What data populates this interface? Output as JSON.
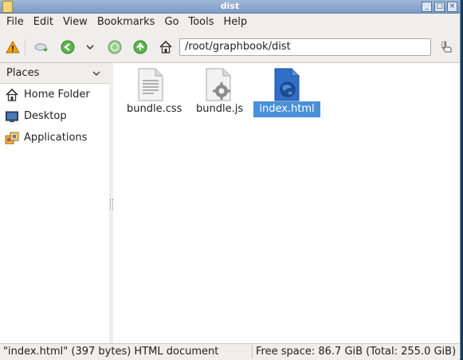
{
  "window": {
    "title": "dist"
  },
  "menubar": {
    "items": [
      "File",
      "Edit",
      "View",
      "Bookmarks",
      "Go",
      "Tools",
      "Help"
    ]
  },
  "toolbar": {
    "location": "/root/graphbook/dist"
  },
  "sidepane": {
    "header": "Places",
    "items": [
      {
        "label": "Home Folder",
        "icon": "home-icon"
      },
      {
        "label": "Desktop",
        "icon": "desktop-icon"
      },
      {
        "label": "Applications",
        "icon": "applications-icon"
      }
    ]
  },
  "files": [
    {
      "name": "bundle.css",
      "icon": "css-file-icon"
    },
    {
      "name": "bundle.js",
      "icon": "js-file-icon"
    },
    {
      "name": "index.html",
      "icon": "html-file-icon",
      "selected": true
    }
  ],
  "statusbar": {
    "selection": "\"index.html\" (397 bytes) HTML document",
    "free_space": "Free space: 86.7 GiB (Total: 255.0 GiB)"
  },
  "colors": {
    "selection": "#4a90d9",
    "titlebar": "#7d9cc7"
  }
}
